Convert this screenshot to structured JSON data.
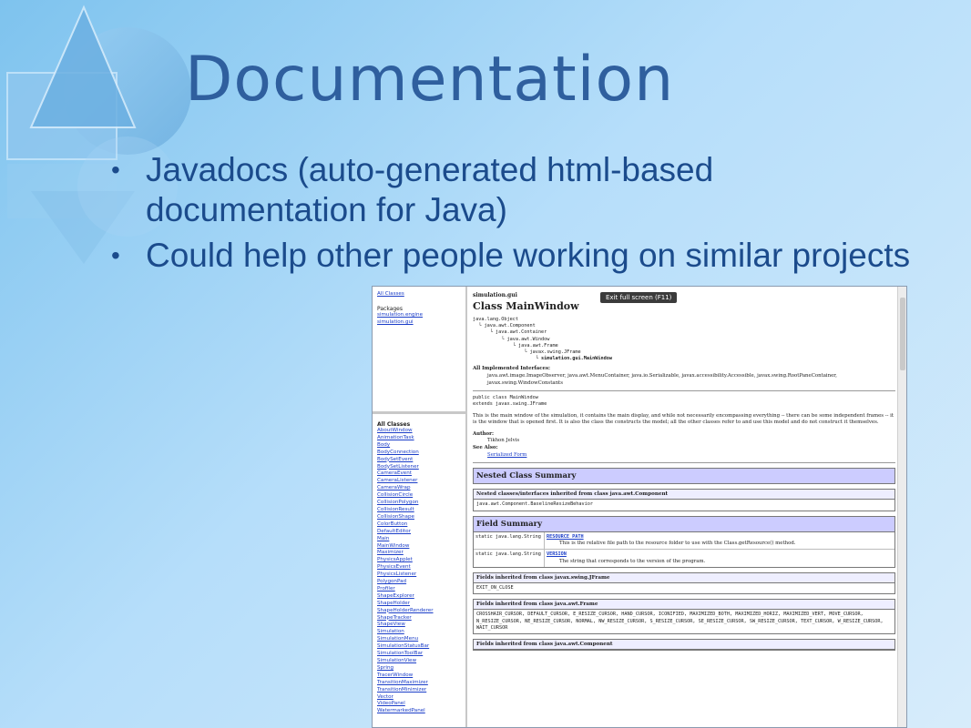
{
  "slide": {
    "title": "Documentation",
    "bullets": [
      "Javadocs (auto-generated html-based documentation for Java)",
      "Could help other people working on similar projects"
    ],
    "bullet_glyph": "•"
  },
  "colors": {
    "title": "#2f5f9e",
    "bullet_text": "#1b4b8c",
    "link": "#1a3dc8",
    "table_header": "#ccccff",
    "subheader": "#eeeeff"
  },
  "javadoc": {
    "fullscreen_toast": "Exit full screen (F11)",
    "packages_pane": {
      "all_classes_link": "All Classes",
      "packages_label": "Packages",
      "packages": [
        "simulation.engine",
        "simulation.gui"
      ]
    },
    "classes_pane": {
      "heading": "All Classes",
      "classes": [
        "AboutWindow",
        "AnimationTask",
        "Body",
        "BodyConnection",
        "BodySetEvent",
        "BodySetListener",
        "CameraEvent",
        "CameraListener",
        "CameraWrap",
        "CollisionCircle",
        "CollisionPolygon",
        "CollisionResult",
        "CollisionShape",
        "ColorButton",
        "DefaultEditor",
        "Main",
        "MainWindow",
        "Maximizer",
        "PhysicsApplet",
        "PhysicsEvent",
        "PhysicsListener",
        "PolygonPad",
        "Profiler",
        "ShapeExplorer",
        "ShapeHolder",
        "ShapeHolderRenderer",
        "ShapeTracker",
        "ShapeView",
        "Simulation",
        "SimulationMenu",
        "SimulationStatusBar",
        "SimulationToolBar",
        "SimulationView",
        "Spring",
        "TracerWindow",
        "TransitionMaximizer",
        "TransitionMinimizer",
        "Vector",
        "VideoPanel",
        "WatermarkedPanel"
      ]
    },
    "main": {
      "package_name": "simulation.gui",
      "class_title": "Class MainWindow",
      "hierarchy": [
        "java.lang.Object",
        "  └ java.awt.Component",
        "      └ java.awt.Container",
        "          └ java.awt.Window",
        "              └ java.awt.Frame",
        "                  └ javax.swing.JFrame",
        "                      └ simulation.gui.MainWindow"
      ],
      "interfaces_label": "All Implemented Interfaces:",
      "interfaces_text": "java.awt.image.ImageObserver, java.awt.MenuContainer, java.io.Serializable, javax.accessibility.Accessible, javax.swing.RootPaneContainer, javax.swing.WindowConstants",
      "declaration": "public class MainWindow\nextends javax.swing.JFrame",
      "description": "This is the main window of the simulation, it contains the main display, and while not necessarily encompassing everything -- there can be some independent frames -- it is the window that is opened first. It is also the class the constructs the model; all the other classes refer to and use this model and do not construct it themselves.",
      "author_label": "Author:",
      "author": "Tikhon Jelvis",
      "see_also_label": "See Also:",
      "see_also_link": "Serialized Form",
      "nested_summary_title": "Nested Class Summary",
      "nested_inherited_title": "Nested classes/interfaces inherited from class java.awt.Component",
      "nested_inherited_value": "java.awt.Component.BaselineResizeBehavior",
      "field_summary_title": "Field Summary",
      "fields": [
        {
          "type": "static java.lang.String",
          "name": "RESOURCE_PATH",
          "desc": "This is the relative file path to the resource folder to use with the Class.getResource() method."
        },
        {
          "type": "static java.lang.String",
          "name": "VERSION",
          "desc": "The string that corresponds to the version of the program."
        }
      ],
      "inherited_jframe_title": "Fields inherited from class javax.swing.JFrame",
      "inherited_jframe_value": "EXIT_ON_CLOSE",
      "inherited_frame_title": "Fields inherited from class java.awt.Frame",
      "inherited_frame_value": "CROSSHAIR_CURSOR, DEFAULT_CURSOR, E_RESIZE_CURSOR, HAND_CURSOR, ICONIFIED, MAXIMIZED_BOTH, MAXIMIZED_HORIZ, MAXIMIZED_VERT, MOVE_CURSOR, N_RESIZE_CURSOR, NE_RESIZE_CURSOR, NORMAL, NW_RESIZE_CURSOR, S_RESIZE_CURSOR, SE_RESIZE_CURSOR, SW_RESIZE_CURSOR, TEXT_CURSOR, W_RESIZE_CURSOR, WAIT_CURSOR",
      "inherited_component_title": "Fields inherited from class java.awt.Component"
    }
  }
}
